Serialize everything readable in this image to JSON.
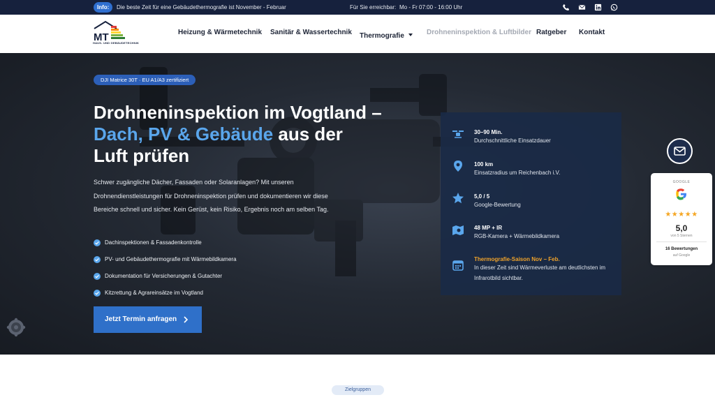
{
  "topbar": {
    "info_badge": "Info:",
    "info_text": "Die beste Zeit für eine Gebäudethermografie ist November - Februar",
    "reach_label": "Für Sie erreichbar:",
    "reach_hours": "Mo - Fr 07:00 - 16:00 Uhr",
    "icons": [
      "phone-icon",
      "mail-icon",
      "linkedin-icon",
      "whatsapp-icon"
    ]
  },
  "logo": {
    "mark": "MT",
    "subtitle": "HAUS- UND GEBÄUDETECHNIK"
  },
  "nav": {
    "items": [
      {
        "label": "Heizung & Wärmetechnik"
      },
      {
        "label": "Sanitär & Wassertechnik"
      },
      {
        "label": "Thermografie"
      },
      {
        "label": "Drohneninspektion & Luftbilder"
      },
      {
        "label": "Ratgeber"
      },
      {
        "label": "Kontakt"
      }
    ],
    "active": "Drohneninspektion & Luftbilder"
  },
  "hero": {
    "badge": "DJI Matrice 30T · EU A1/A3 zertifiziert",
    "headline_part1": "Drohneninspektion im Vogtland –",
    "headline_accent": "Dach, PV & Gebäude",
    "headline_part2": " aus der",
    "headline_part3": "Luft prüfen",
    "intro": "Schwer zugängliche Dächer, Fassaden oder Solaranlagen? Mit unseren Drohnendienstleistungen für Drohneninspektion prüfen und dokumentieren wir diese Bereiche schnell und sicher. Kein Gerüst, kein Risiko, Ergebnis noch am selben Tag.",
    "checklist": [
      "Dachinspektionen & Fassadenkontrolle",
      "PV- und Gebäudethermografie mit Wärmebildkamera",
      "Dokumentation für Versicherungen & Gutachter",
      "Kitzrettung & Agrareinsätze im Vogtland"
    ],
    "cta_label": "Jetzt Termin anfragen"
  },
  "stats": [
    {
      "icon": "drone-icon",
      "title": "30–90 Min.",
      "desc": "Durchschnittliche Einsatzdauer"
    },
    {
      "icon": "location-pin-icon",
      "title": "100 km",
      "desc": "Einsatzradius um Reichenbach i.V."
    },
    {
      "icon": "star-icon",
      "title": "5,0 / 5",
      "desc": "Google-Bewertung"
    },
    {
      "icon": "map-camera-icon",
      "title": "48 MP + IR",
      "desc": "RGB-Kamera + Wärmebildkamera"
    },
    {
      "icon": "calendar-icon",
      "title": "Thermografie-Saison Nov – Feb.",
      "desc": "In dieser Zeit sind Wärmeverluste am deutlichsten im Infrarotbild sichtbar."
    }
  ],
  "google_widget": {
    "label": "GOOGLE",
    "stars": "★★★★★",
    "rating": 5.0,
    "score": "5,0",
    "of_text": "von 5 Sternen",
    "count": "16 Bewertungen",
    "source": "auf Google"
  },
  "below_hero": {
    "pill": "Zielgruppen"
  },
  "colors": {
    "topbar": "#16213d",
    "accent_blue": "#5aa6ec",
    "button_blue": "#2f70c9",
    "orange": "#f0a32a",
    "card_bg": "#1a2a46"
  }
}
